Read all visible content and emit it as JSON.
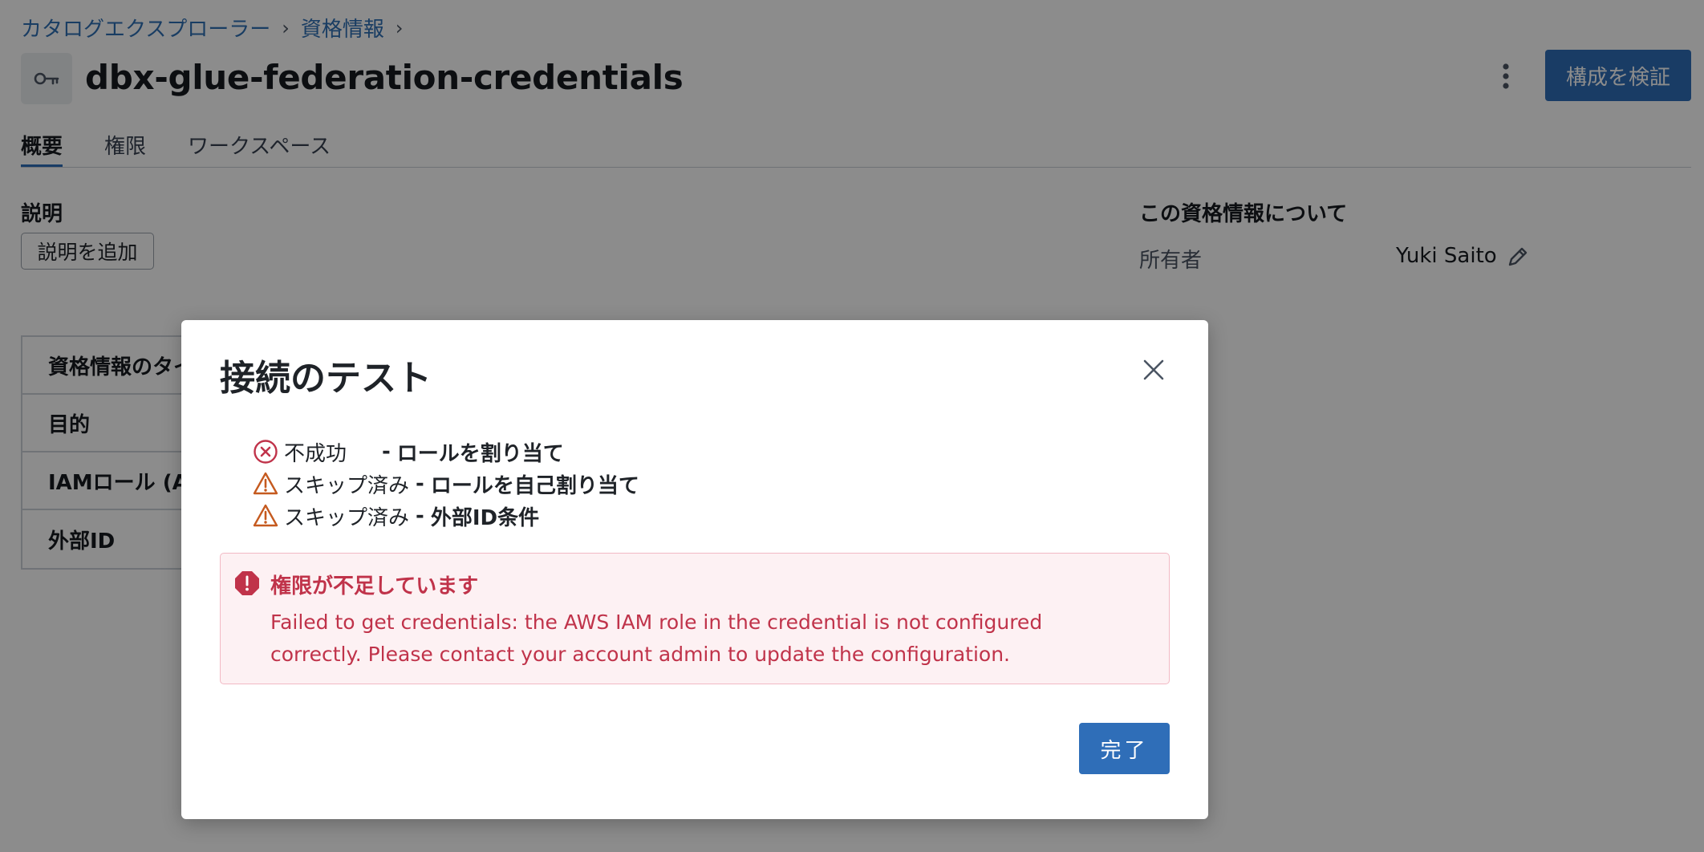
{
  "breadcrumb": {
    "items": [
      "カタログエクスプローラー",
      "資格情報"
    ],
    "separator": "›"
  },
  "header": {
    "title": "dbx-glue-federation-credentials",
    "verify_label": "構成を検証"
  },
  "tabs": [
    {
      "label": "概要",
      "active": true
    },
    {
      "label": "権限",
      "active": false
    },
    {
      "label": "ワークスペース",
      "active": false
    }
  ],
  "description": {
    "label": "説明",
    "add_button": "説明を追加"
  },
  "about": {
    "title": "この資格情報について",
    "owner_label": "所有者",
    "owner_value": "Yuki Saito"
  },
  "details": {
    "rows": [
      "資格情報のタイプ",
      "目的",
      "IAMロール (ARN)",
      "外部ID"
    ]
  },
  "modal": {
    "title": "接続のテスト",
    "results": [
      {
        "status": "不成功",
        "dash": "-",
        "check": "ロールを割り当て",
        "icon": "error-circle-icon"
      },
      {
        "status": "スキップ済み",
        "dash": "-",
        "check": "ロールを自己割り当て",
        "icon": "warning-triangle-icon"
      },
      {
        "status": "スキップ済み",
        "dash": "-",
        "check": "外部ID条件",
        "icon": "warning-triangle-icon"
      }
    ],
    "alert": {
      "title": "権限が不足しています",
      "message": "Failed to get credentials: the AWS IAM role in the credential is not configured correctly. Please contact your account admin to update the configuration."
    },
    "done_label": "完了"
  },
  "colors": {
    "accent": "#2f6eb8",
    "error": "#c0334a",
    "warning": "#c55a1f",
    "link": "#2f6fb4"
  }
}
